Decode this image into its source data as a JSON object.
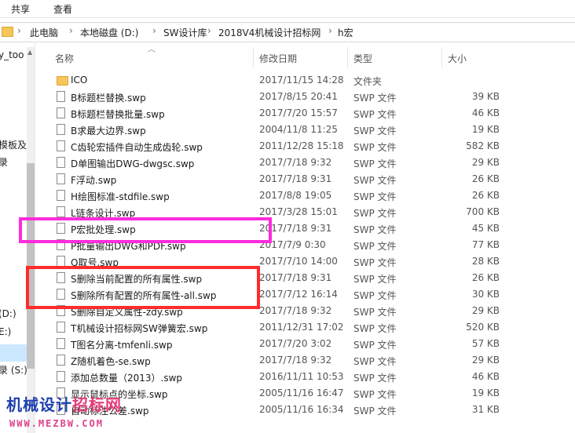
{
  "ribbon": {
    "share": "共享",
    "view": "查看"
  },
  "breadcrumb": [
    "此电脑",
    "本地磁盘 (D:)",
    "SW设计库",
    "2018V4机械设计招标网",
    "h宏"
  ],
  "breadcrumb_sep": "›",
  "nav": [
    "y_too",
    "模板及",
    "录",
    "(D:)",
    "E:)",
    "录 (S:)"
  ],
  "columns": {
    "name": "名称",
    "date": "修改日期",
    "type": "类型",
    "size": "大小"
  },
  "rows": [
    {
      "name": "ICO",
      "date": "2017/11/15 14:28",
      "type": "文件夹",
      "size": "",
      "icon": "folder-icon"
    },
    {
      "name": "B标题栏替换.swp",
      "date": "2017/8/15 20:41",
      "type": "SWP 文件",
      "size": "39 KB",
      "icon": "file-icon"
    },
    {
      "name": "B标题栏替换批量.swp",
      "date": "2017/7/20 15:57",
      "type": "SWP 文件",
      "size": "46 KB",
      "icon": "file-icon"
    },
    {
      "name": "B求最大边界.swp",
      "date": "2004/11/8 11:25",
      "type": "SWP 文件",
      "size": "19 KB",
      "icon": "file-icon"
    },
    {
      "name": "C齿轮宏插件自动生成齿轮.swp",
      "date": "2011/12/28 15:18",
      "type": "SWP 文件",
      "size": "582 KB",
      "icon": "file-icon"
    },
    {
      "name": "D单图输出DWG-dwgsc.swp",
      "date": "2017/7/18 9:32",
      "type": "SWP 文件",
      "size": "29 KB",
      "icon": "file-icon"
    },
    {
      "name": "F浮动.swp",
      "date": "2017/7/18 9:31",
      "type": "SWP 文件",
      "size": "26 KB",
      "icon": "file-icon"
    },
    {
      "name": "H绘图标准-stdfile.swp",
      "date": "2017/8/8 19:05",
      "type": "SWP 文件",
      "size": "26 KB",
      "icon": "file-icon"
    },
    {
      "name": "L链条设计.swp",
      "date": "2017/3/28 15:01",
      "type": "SWP 文件",
      "size": "700 KB",
      "icon": "file-icon"
    },
    {
      "name": "P宏批处理.swp",
      "date": "2017/7/18 9:31",
      "type": "SWP 文件",
      "size": "45 KB",
      "icon": "file-icon"
    },
    {
      "name": "P批量输出DWG和PDF.swp",
      "date": "2017/7/9 0:30",
      "type": "SWP 文件",
      "size": "77 KB",
      "icon": "file-icon"
    },
    {
      "name": "Q取号.swp",
      "date": "2017/7/10 14:00",
      "type": "SWP 文件",
      "size": "28 KB",
      "icon": "file-icon"
    },
    {
      "name": "S删除当前配置的所有属性.swp",
      "date": "2017/7/18 9:31",
      "type": "SWP 文件",
      "size": "26 KB",
      "icon": "file-icon"
    },
    {
      "name": "S删除所有配置的所有属性-all.swp",
      "date": "2017/7/12 16:14",
      "type": "SWP 文件",
      "size": "30 KB",
      "icon": "file-icon"
    },
    {
      "name": "S删除自定义属性-zdy.swp",
      "date": "2017/7/18 9:32",
      "type": "SWP 文件",
      "size": "29 KB",
      "icon": "file-icon"
    },
    {
      "name": "T机械设计招标网SW弹簧宏.swp",
      "date": "2011/12/31 17:02",
      "type": "SWP 文件",
      "size": "520 KB",
      "icon": "file-icon"
    },
    {
      "name": "T图名分离-tmfenli.swp",
      "date": "2017/7/20 3:02",
      "type": "SWP 文件",
      "size": "57 KB",
      "icon": "file-icon"
    },
    {
      "name": "Z随机着色-se.swp",
      "date": "2017/7/18 9:32",
      "type": "SWP 文件",
      "size": "29 KB",
      "icon": "file-icon"
    },
    {
      "name": "添加总数量（2013）.swp",
      "date": "2016/11/11 10:53",
      "type": "SWP 文件",
      "size": "46 KB",
      "icon": "file-icon"
    },
    {
      "name": "显示鼠标点的坐标.swp",
      "date": "2005/11/16 16:47",
      "type": "SWP 文件",
      "size": "19 KB",
      "icon": "file-icon"
    },
    {
      "name": "自动标注公差.swp",
      "date": "2005/11/16 16:34",
      "type": "SWP 文件",
      "size": "31 KB",
      "icon": "file-icon"
    }
  ],
  "watermark": {
    "part1": "机械设计",
    "part2": "招标网",
    "url": "WWW.MEZBW.COM"
  },
  "colors": {
    "highlight_magenta": "#ff2bdc",
    "highlight_red": "#ff2a2a",
    "selection": "#cce8ff",
    "folder": "#f6c65b"
  }
}
